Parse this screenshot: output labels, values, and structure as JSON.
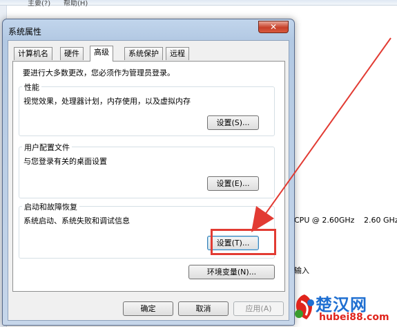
{
  "background": {
    "top_fragments": [
      "主要(?)",
      "帮助(H)"
    ],
    "cpu_text": "CPU @ 2.60GHz",
    "cpu_speed": "2.60 GHz",
    "input_text": "输入"
  },
  "dialog": {
    "title": "系统属性",
    "close_symbol": "✕",
    "tabs": [
      "计算机名",
      "硬件",
      "高级",
      "系统保护",
      "远程"
    ],
    "active_tab": "高级",
    "admin_notice": "要进行大多数更改，您必须作为管理员登录。",
    "groups": {
      "performance": {
        "title": "性能",
        "description": "视觉效果，处理器计划，内存使用，以及虚拟内存",
        "button": "设置(S)..."
      },
      "user_profiles": {
        "title": "用户配置文件",
        "description": "与您登录有关的桌面设置",
        "button": "设置(E)..."
      },
      "startup_recovery": {
        "title": "启动和故障恢复",
        "description": "系统启动、系统失败和调试信息",
        "button": "设置(T)..."
      }
    },
    "env_button": "环境变量(N)...",
    "ok": "确定",
    "cancel": "取消",
    "apply": "应用(A)"
  },
  "annotation_color": "#e23b33",
  "watermark": {
    "title": "楚汉网",
    "url": "hubei88.com"
  }
}
